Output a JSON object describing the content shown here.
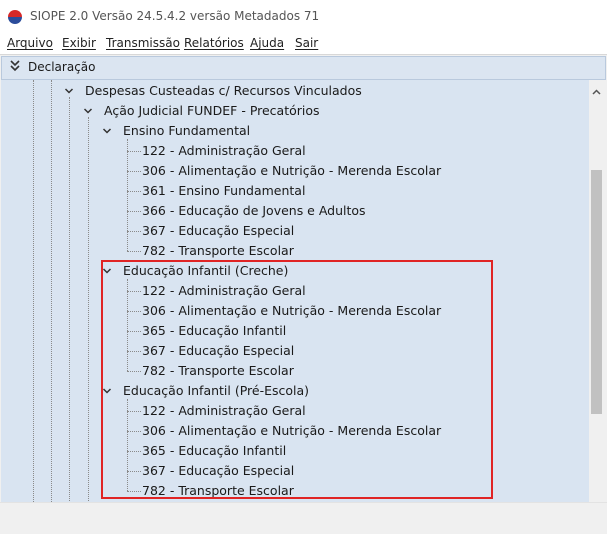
{
  "app": {
    "title": "SIOPE 2.0  Versão 24.5.4.2 versão Metadados 71"
  },
  "menu": [
    "Arquivo",
    "Exibir",
    "Transmissão",
    "Relatórios",
    "Ajuda",
    "Sair"
  ],
  "panel": {
    "title": "Declaração"
  },
  "tree": {
    "root_label": "Despesas Custeadas c/ Recursos Vinculados",
    "branch_label": "Ação Judicial FUNDEF - Precatórios",
    "groups": [
      {
        "label": "Ensino Fundamental",
        "items": [
          "122 - Administração Geral",
          "306 - Alimentação e Nutrição - Merenda Escolar",
          "361 - Ensino Fundamental",
          "366 - Educação de Jovens e Adultos",
          "367 - Educação Especial",
          "782 - Transporte Escolar"
        ]
      },
      {
        "label": "Educação Infantil (Creche)",
        "items": [
          "122 - Administração Geral",
          "306 - Alimentação e Nutrição - Merenda Escolar",
          "365 - Educação Infantil",
          "367 - Educação Especial",
          "782 - Transporte Escolar"
        ]
      },
      {
        "label": "Educação Infantil (Pré-Escola)",
        "items": [
          "122 - Administração Geral",
          "306 - Alimentação e Nutrição - Merenda Escolar",
          "365 - Educação Infantil",
          "367 - Educação Especial",
          "782 - Transporte Escolar"
        ]
      }
    ]
  },
  "colors": {
    "tree_bg": "#d9e4f1",
    "header_bg": "#dbe5f1",
    "highlight": "#e02424"
  }
}
